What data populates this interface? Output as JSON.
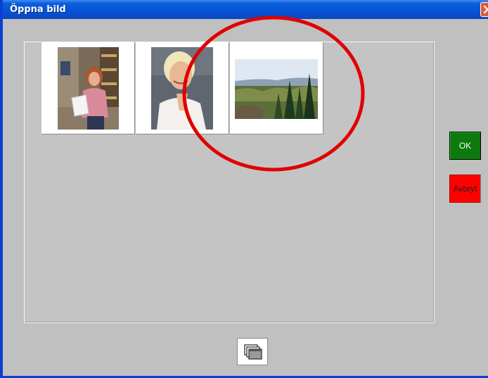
{
  "window": {
    "title": "Öppna bild",
    "close_icon": "close-icon"
  },
  "gallery": {
    "thumbnails": [
      {
        "subject": "woman-holding-paper-photo"
      },
      {
        "subject": "smiling-woman-portrait-photo"
      },
      {
        "subject": "forest-landscape-photo"
      }
    ]
  },
  "buttons": {
    "ok_label": "OK",
    "cancel_label": "Avbryt",
    "browse_icon": "stacked-windows-icon"
  },
  "colors": {
    "titlebar": "#0553d6",
    "ok": "#0c7a0c",
    "cancel": "#ff0000",
    "highlight_circle": "#e00000"
  }
}
